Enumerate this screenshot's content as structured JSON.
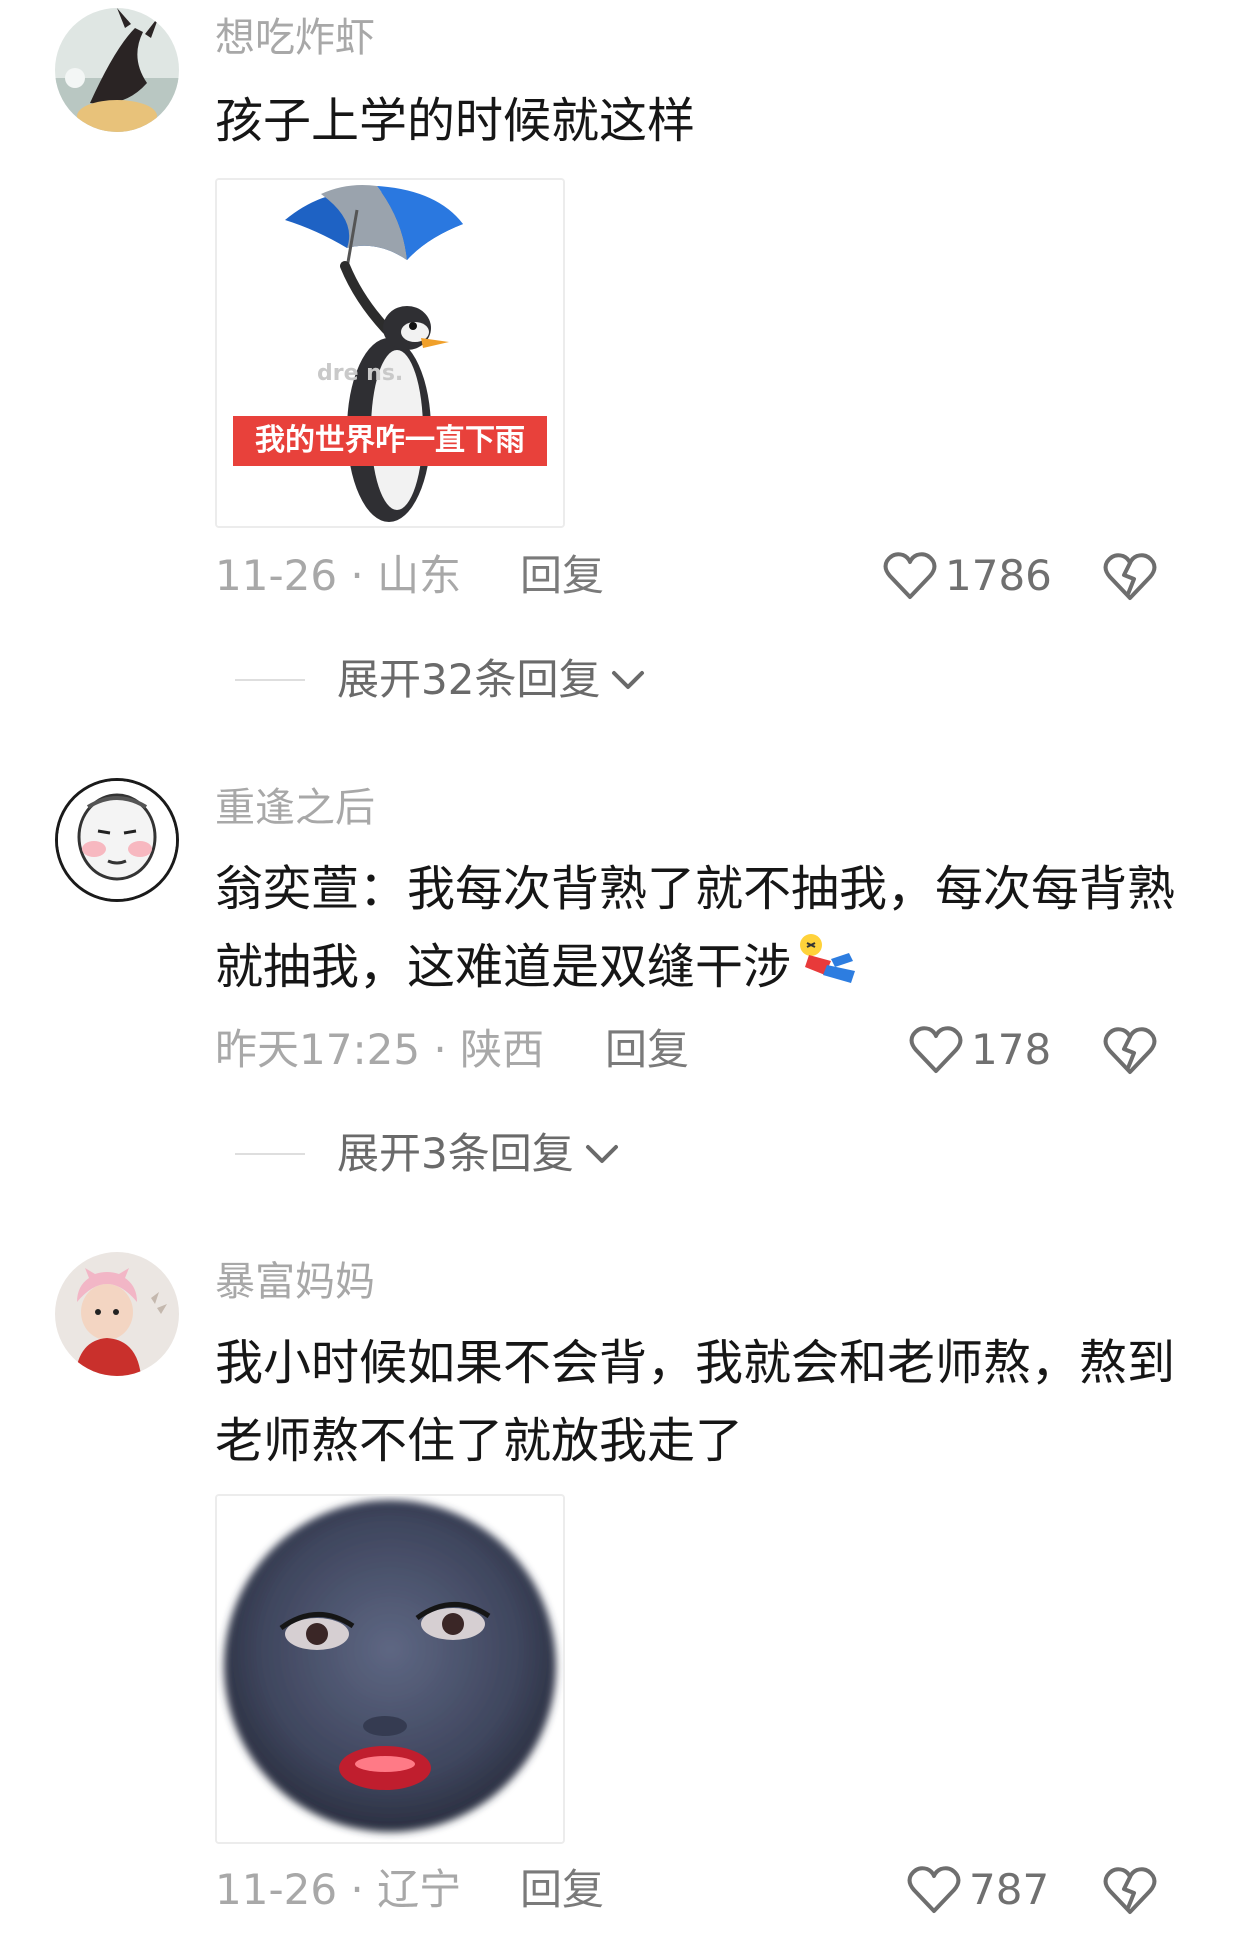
{
  "comments": [
    {
      "username": "想吃炸虾",
      "text": "孩子上学的时候就这样",
      "sticker_caption": "我的世界咋一直下雨",
      "sticker_watermark": "dre      ns.",
      "date_location": "11-26 · 山东",
      "reply_label": "回复",
      "likes": "1786",
      "expand_label": "展开32条回复"
    },
    {
      "username": "重逢之后",
      "text": "翁奕萱：我每次背熟了就不抽我，每次每背熟就抽我，这难道是双缝干涉",
      "date_location": "昨天17:25 · 陕西",
      "reply_label": "回复",
      "likes": "178",
      "expand_label": "展开3条回复"
    },
    {
      "username": "暴富妈妈",
      "text": "我小时候如果不会背，我就会和老师熬，熬到老师熬不住了就放我走了",
      "date_location": "11-26 · 辽宁",
      "reply_label": "回复",
      "likes": "787"
    }
  ],
  "icons": {
    "like": "heart-outline-icon",
    "dislike": "broken-heart-icon",
    "expand": "chevron-down-icon",
    "emoji": "fallen-person-emoji-icon"
  },
  "colors": {
    "username": "#a8a8a8",
    "text": "#161616",
    "meta": "#a8a8a8",
    "caption_bg": "#e8413b"
  }
}
